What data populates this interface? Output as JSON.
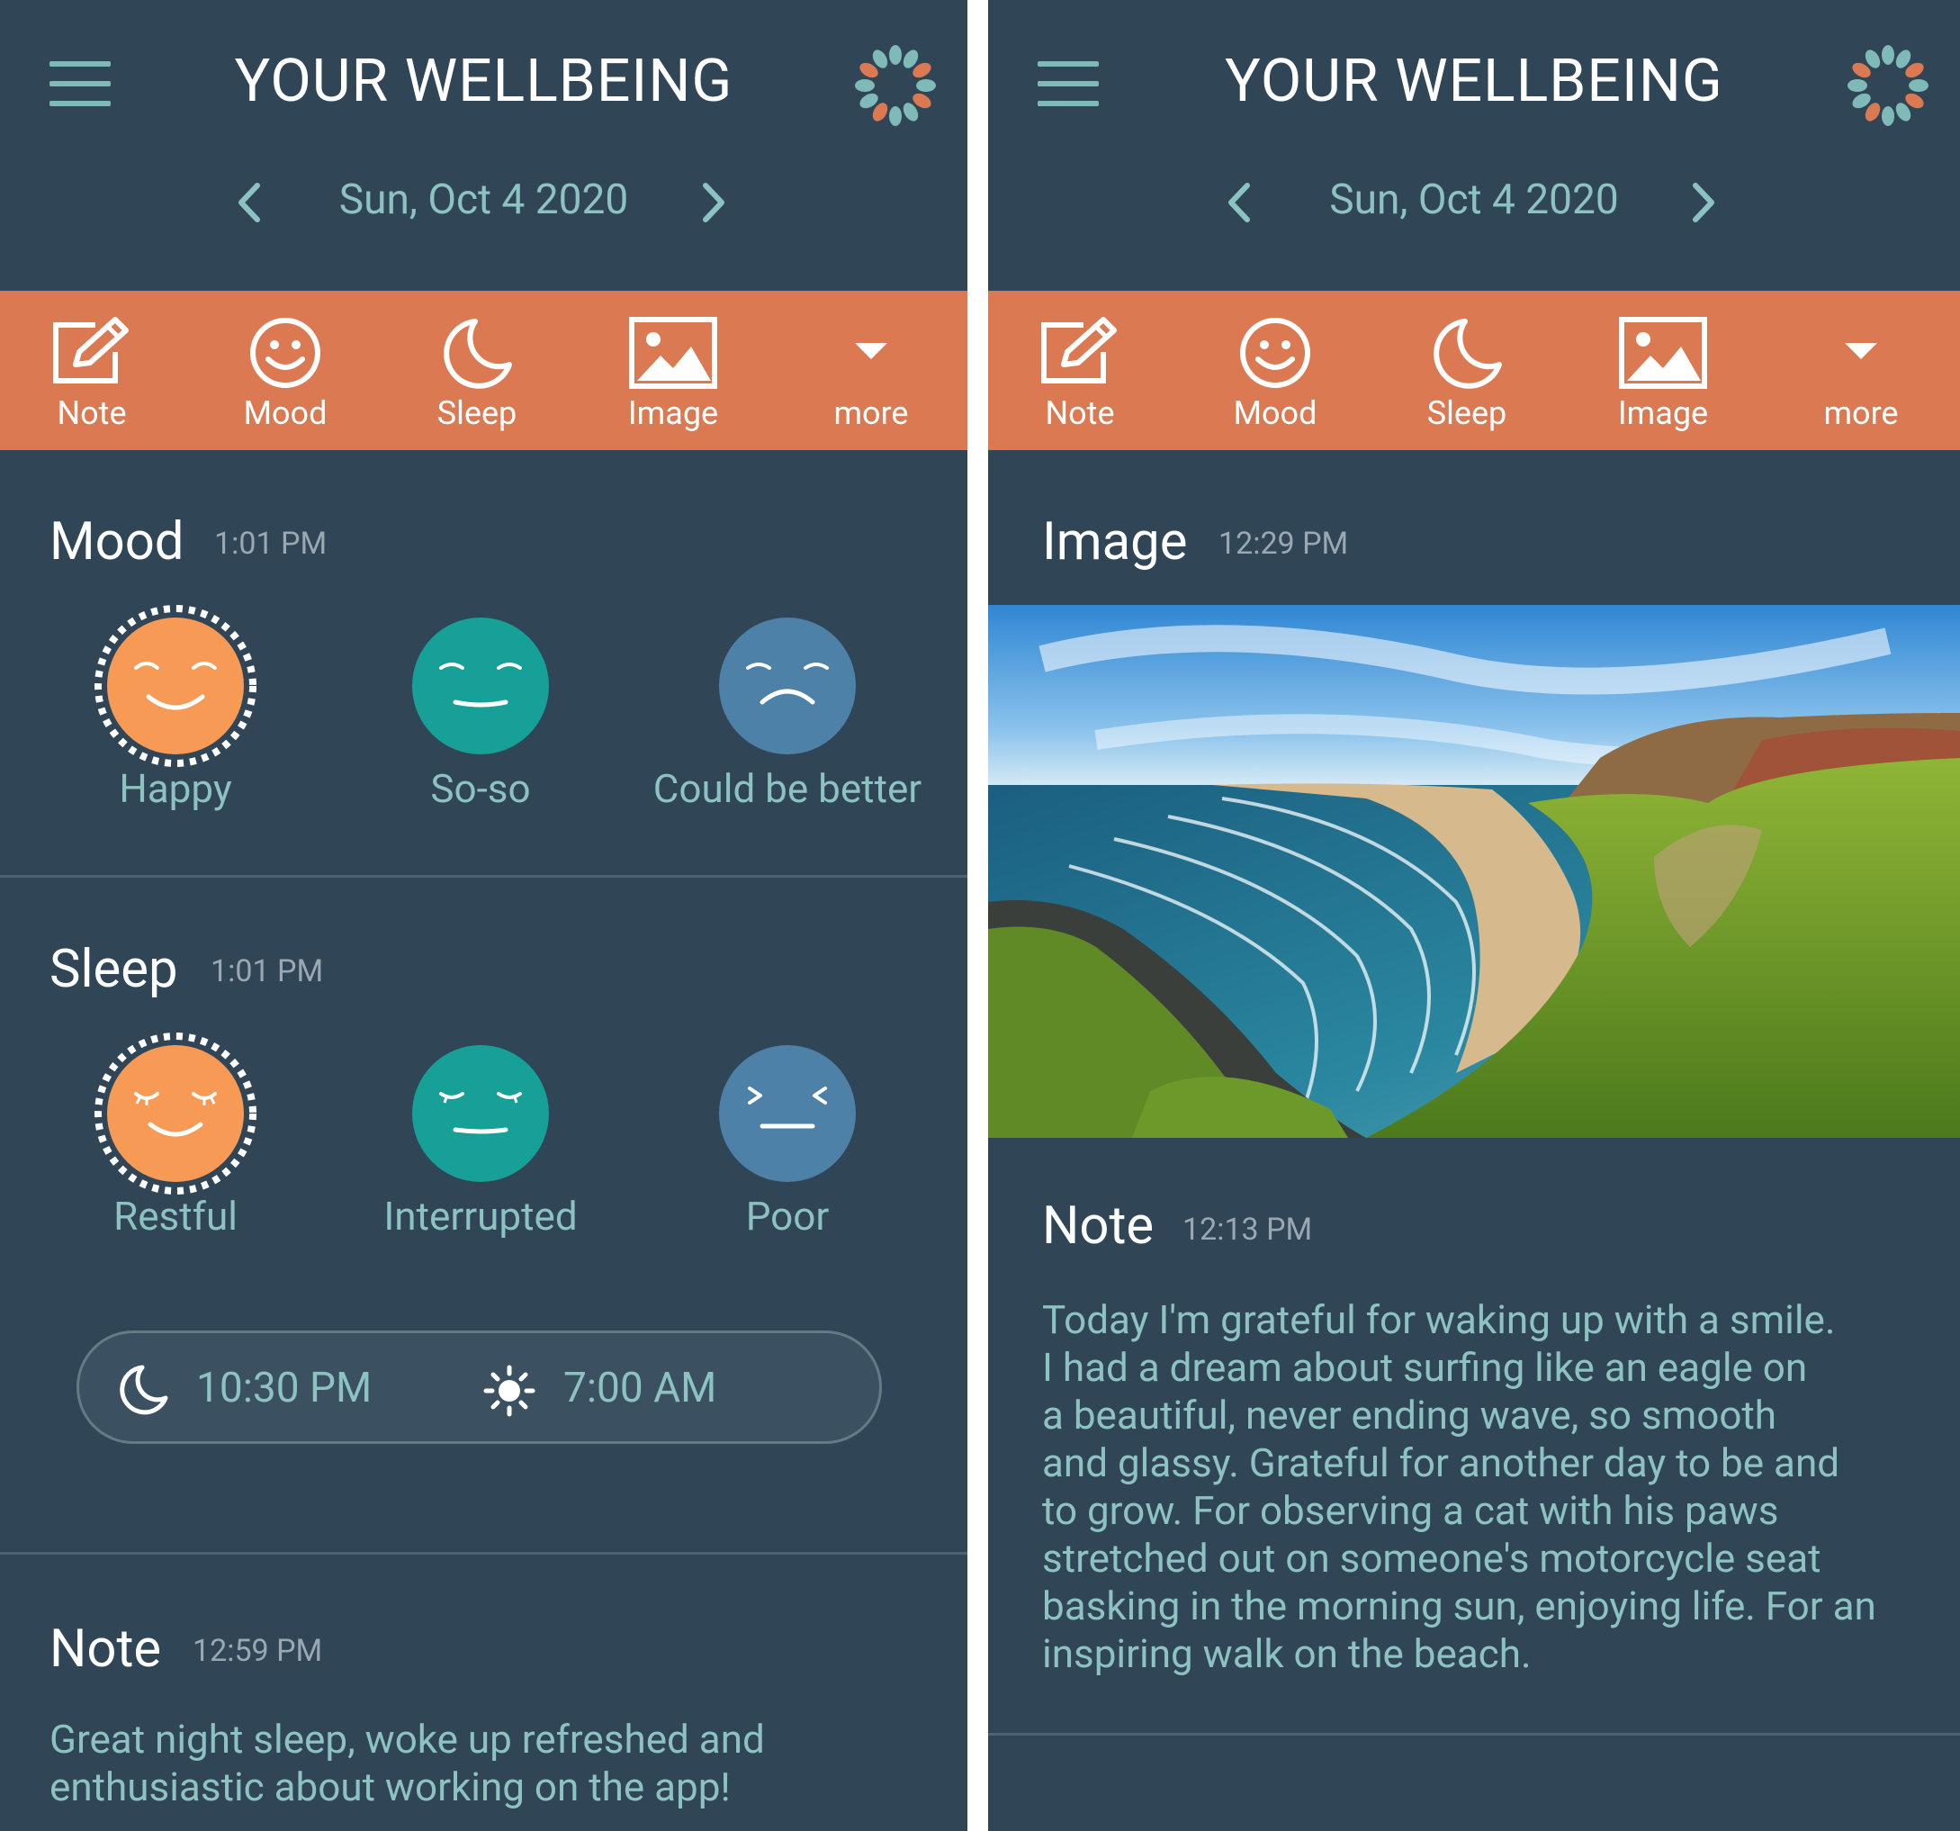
{
  "left": {
    "title": "YOUR WELLBEING",
    "date": "Sun, Oct 4 2020",
    "toolbar": [
      {
        "label": "Note",
        "icon": "note-edit-icon"
      },
      {
        "label": "Mood",
        "icon": "smiley-icon"
      },
      {
        "label": "Sleep",
        "icon": "moon-icon"
      },
      {
        "label": "Image",
        "icon": "image-icon"
      },
      {
        "label": "more",
        "icon": "caret-down-icon"
      }
    ],
    "mood": {
      "title": "Mood",
      "time": "1:01 PM",
      "options": [
        {
          "label": "Happy",
          "selected": true,
          "color": "#f79a55"
        },
        {
          "label": "So-so",
          "selected": false,
          "color": "#16a098"
        },
        {
          "label": "Could be better",
          "selected": false,
          "color": "#4e81a8"
        }
      ]
    },
    "sleep": {
      "title": "Sleep",
      "time": "1:01 PM",
      "options": [
        {
          "label": "Restful",
          "selected": true,
          "color": "#f79a55"
        },
        {
          "label": "Interrupted",
          "selected": false,
          "color": "#16a098"
        },
        {
          "label": "Poor",
          "selected": false,
          "color": "#4e81a8"
        }
      ],
      "bedtime": "10:30 PM",
      "waketime": "7:00 AM"
    },
    "note": {
      "title": "Note",
      "time": "12:59 PM",
      "lines": [
        "Great night sleep, woke up refreshed and",
        "enthusiastic about working on the app!"
      ]
    }
  },
  "right": {
    "title": "YOUR WELLBEING",
    "date": "Sun, Oct 4 2020",
    "toolbar": [
      {
        "label": "Note",
        "icon": "note-edit-icon"
      },
      {
        "label": "Mood",
        "icon": "smiley-icon"
      },
      {
        "label": "Sleep",
        "icon": "moon-icon"
      },
      {
        "label": "Image",
        "icon": "image-icon"
      },
      {
        "label": "more",
        "icon": "caret-down-icon"
      }
    ],
    "image": {
      "title": "Image",
      "time": "12:29 PM"
    },
    "note": {
      "title": "Note",
      "time": "12:13 PM",
      "lines": [
        "Today I'm grateful for waking up with a smile.",
        "I had a dream about surfing like an eagle on",
        "a beautiful, never ending wave, so smooth",
        "and glassy. Grateful for another day to be and",
        "to grow. For observing a cat with his paws",
        "stretched out on someone's motorcycle seat",
        "basking in the morning sun, enjoying life. For an",
        "inspiring walk on the beach."
      ]
    }
  },
  "colors": {
    "background": "#304656",
    "accent_orange": "#db7a52",
    "text_teal": "#8cc2c2",
    "happy": "#f79a55",
    "neutral": "#16a098",
    "sad": "#4e81a8"
  }
}
